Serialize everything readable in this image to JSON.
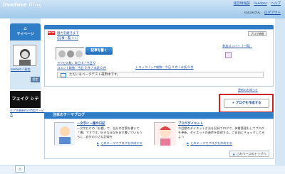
{
  "header": {
    "logo_prefix": "livedoor",
    "logo_blog": "Blog",
    "top_links": [
      "経営情報部",
      "livedoor",
      "ヘルプ"
    ],
    "user_label": "sanaeさん",
    "logout": "ログアウト"
  },
  "sidebar": {
    "mypage_label": "マイページ",
    "nickname_links": "sanaeh / 発信",
    "settings_button": "設定",
    "ad_title": "フェイク シティ",
    "ad_caption": "キアヌ最新作の特製サービス"
  },
  "main": {
    "new_badge": "NEW",
    "news_line1": "魅力を磨きまで",
    "news_line2": "(記事一覧 >>)",
    "news_button": "ブログ新着",
    "write_button": "記事を書く",
    "stats_line1": "アクセス数：昨日 0 / 今日 0",
    "stats_line2": "コメント総数：今日 0 件 / 未読 0 件",
    "stats_trackback": "トラックバック総数：今日 0 件 / 未読 0 件",
    "member_title": "参加メンバー（一覧）",
    "tagline": "ただいまベータテスト運用中です。",
    "under_link": "更新のお知らせ"
  },
  "create_blog_button": "ブログを作成する",
  "theme": {
    "title": "注目のテーマブログ",
    "items": [
      {
        "title": "一文字に一箇の日記",
        "body": "一文字だけの「お題」で、自分の言葉を書いて「書」ですです。好きな日記を日々書いているうちに...自分の小さな記録を",
        "link": "このテーマでブログを作成する"
      },
      {
        "title": "ブログダイエット",
        "body": "今話題のダイエット方法を記録ブログで、体重管理もしてブログを更新。ダイエットの進捗を管理する。ご自由にチェックしてみよう",
        "link": "このテーマでブログを作成する"
      }
    ],
    "top_button": "このページのトップへ"
  },
  "colors": {
    "accent": "#2f7cc7",
    "highlight": "#d02222"
  }
}
